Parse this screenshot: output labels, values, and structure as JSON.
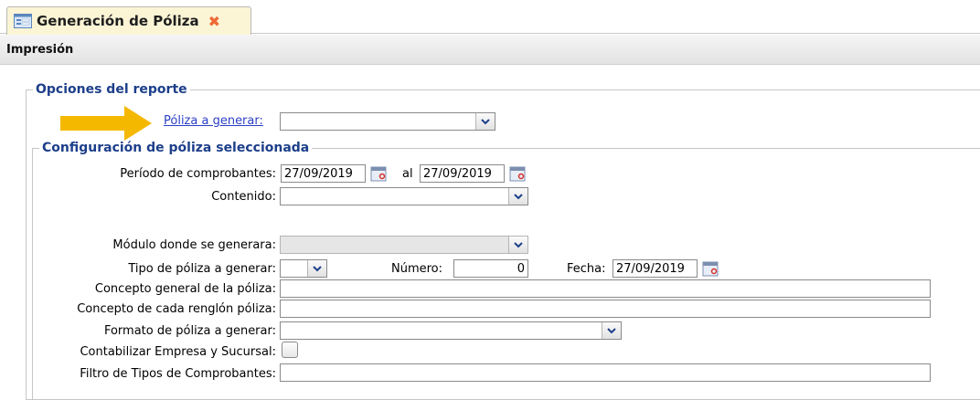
{
  "tab": {
    "title": "Generación de Póliza",
    "close": "✖"
  },
  "section": {
    "title": "Impresión"
  },
  "report_options": {
    "legend": "Opciones del reporte",
    "policy_link": "Póliza a generar:",
    "policy_value": ""
  },
  "config": {
    "legend": "Configuración de póliza seleccionada",
    "period_label": "Período de comprobantes:",
    "period_from": "27/09/2019",
    "period_to_label": "al",
    "period_to": "27/09/2019",
    "content_label": "Contenido:",
    "content_value": "",
    "module_label": "Módulo donde se generara:",
    "module_value": "",
    "policy_type_label": "Tipo de póliza a generar:",
    "policy_type_value": "",
    "number_label": "Número:",
    "number_value": "0",
    "date_label": "Fecha:",
    "date_value": "27/09/2019",
    "general_concept_label": "Concepto general de la póliza:",
    "general_concept_value": "",
    "row_concept_label": "Concepto de cada renglón póliza:",
    "row_concept_value": "",
    "format_label": "Formato de póliza a generar:",
    "format_value": "",
    "account_label": "Contabilizar Empresa y Sucursal:",
    "filter_label": "Filtro de Tipos de Comprobantes:",
    "filter_value": ""
  },
  "colors": {
    "legend": "#1d3f8a",
    "link": "#2b3fc4",
    "tab_bg": "#fbf5d6",
    "close": "#ee6a36",
    "arrow": "#f5b800"
  }
}
